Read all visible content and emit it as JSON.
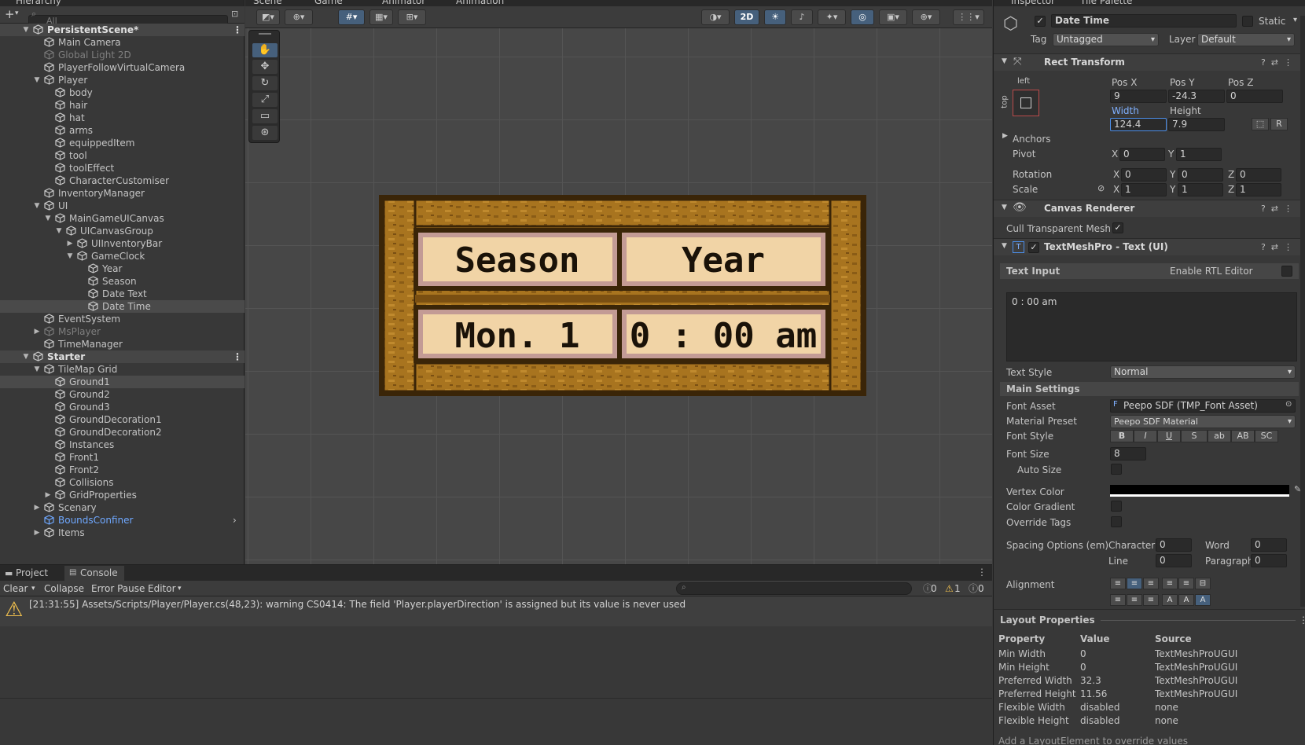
{
  "hierarchy": {
    "tab": "Hierarchy",
    "search_placeholder": "All",
    "rows": [
      {
        "label": "PersistentScene*",
        "depth": 0,
        "type": "scene",
        "arrow": "▼"
      },
      {
        "label": "Main Camera",
        "depth": 1,
        "arrow": ""
      },
      {
        "label": "Global Light 2D",
        "depth": 1,
        "arrow": "",
        "dim": true
      },
      {
        "label": "PlayerFollowVirtualCamera",
        "depth": 1,
        "arrow": ""
      },
      {
        "label": "Player",
        "depth": 1,
        "arrow": "▼"
      },
      {
        "label": "body",
        "depth": 2,
        "arrow": ""
      },
      {
        "label": "hair",
        "depth": 2,
        "arrow": ""
      },
      {
        "label": "hat",
        "depth": 2,
        "arrow": ""
      },
      {
        "label": "arms",
        "depth": 2,
        "arrow": ""
      },
      {
        "label": "equippedItem",
        "depth": 2,
        "arrow": ""
      },
      {
        "label": "tool",
        "depth": 2,
        "arrow": ""
      },
      {
        "label": "toolEffect",
        "depth": 2,
        "arrow": ""
      },
      {
        "label": "CharacterCustomiser",
        "depth": 2,
        "arrow": ""
      },
      {
        "label": "InventoryManager",
        "depth": 1,
        "arrow": ""
      },
      {
        "label": "UI",
        "depth": 1,
        "arrow": "▼"
      },
      {
        "label": "MainGameUICanvas",
        "depth": 2,
        "arrow": "▼"
      },
      {
        "label": "UICanvasGroup",
        "depth": 3,
        "arrow": "▼"
      },
      {
        "label": "UIInventoryBar",
        "depth": 4,
        "arrow": "▶"
      },
      {
        "label": "GameClock",
        "depth": 4,
        "arrow": "▼"
      },
      {
        "label": "Year",
        "depth": 5,
        "arrow": ""
      },
      {
        "label": "Season",
        "depth": 5,
        "arrow": ""
      },
      {
        "label": "Date Text",
        "depth": 5,
        "arrow": ""
      },
      {
        "label": "Date Time",
        "depth": 5,
        "arrow": "",
        "selected": true
      },
      {
        "label": "EventSystem",
        "depth": 1,
        "arrow": ""
      },
      {
        "label": "MsPlayer",
        "depth": 1,
        "arrow": "▶",
        "dim": true
      },
      {
        "label": "TimeManager",
        "depth": 1,
        "arrow": ""
      },
      {
        "label": "Starter",
        "depth": 0,
        "type": "scene",
        "arrow": "▼"
      },
      {
        "label": "TileMap Grid",
        "depth": 1,
        "arrow": "▼"
      },
      {
        "label": "Ground1",
        "depth": 2,
        "arrow": "",
        "hover": true
      },
      {
        "label": "Ground2",
        "depth": 2,
        "arrow": ""
      },
      {
        "label": "Ground3",
        "depth": 2,
        "arrow": ""
      },
      {
        "label": "GroundDecoration1",
        "depth": 2,
        "arrow": ""
      },
      {
        "label": "GroundDecoration2",
        "depth": 2,
        "arrow": ""
      },
      {
        "label": "Instances",
        "depth": 2,
        "arrow": ""
      },
      {
        "label": "Front1",
        "depth": 2,
        "arrow": ""
      },
      {
        "label": "Front2",
        "depth": 2,
        "arrow": ""
      },
      {
        "label": "Collisions",
        "depth": 2,
        "arrow": ""
      },
      {
        "label": "GridProperties",
        "depth": 2,
        "arrow": "▶"
      },
      {
        "label": "Scenary",
        "depth": 1,
        "arrow": "▶"
      },
      {
        "label": "BoundsConfiner",
        "depth": 1,
        "arrow": "",
        "blue": true
      },
      {
        "label": "Items",
        "depth": 1,
        "arrow": "▶"
      }
    ]
  },
  "scene": {
    "tabs": [
      "Scene",
      "Game",
      "Animator",
      "Animation"
    ],
    "toggle_2d": "2D",
    "clock": {
      "season": "Season",
      "year": "Year",
      "date": "Mon. 1",
      "time": "0 : 00 am"
    }
  },
  "inspector": {
    "tabs": [
      "Inspector",
      "Tile Palette"
    ],
    "object_name": "Date Time",
    "static_label": "Static",
    "tag_label": "Tag",
    "tag_value": "Untagged",
    "layer_label": "Layer",
    "layer_value": "Default",
    "rect_transform": {
      "title": "Rect Transform",
      "anchor_h": "left",
      "anchor_v": "top",
      "pos_x_label": "Pos X",
      "pos_x": "9",
      "pos_y_label": "Pos Y",
      "pos_y": "-24.3",
      "pos_z_label": "Pos Z",
      "pos_z": "0",
      "width_label": "Width",
      "width": "124.4",
      "height_label": "Height",
      "height": "7.9",
      "r_button": "R",
      "anchors_label": "Anchors",
      "pivot_label": "Pivot",
      "pivot_x": "0",
      "pivot_y": "1",
      "rotation_label": "Rotation",
      "rot_x": "0",
      "rot_y": "0",
      "rot_z": "0",
      "scale_label": "Scale",
      "scale_x": "1",
      "scale_y": "1",
      "scale_z": "1",
      "axis_x": "X",
      "axis_y": "Y",
      "axis_z": "Z"
    },
    "canvas_renderer": {
      "title": "Canvas Renderer",
      "cull_label": "Cull Transparent Mesh"
    },
    "tmp": {
      "title": "TextMeshPro - Text (UI)",
      "text_input_label": "Text Input",
      "rtl_label": "Enable RTL Editor",
      "text_value": "0 : 00 am",
      "text_style_label": "Text Style",
      "text_style_value": "Normal",
      "main_settings_label": "Main Settings",
      "font_asset_label": "Font Asset",
      "font_asset_value": "Peepo SDF (TMP_Font Asset)",
      "material_label": "Material Preset",
      "material_value": "Peepo SDF Material",
      "font_style_label": "Font Style",
      "font_style_buttons": [
        "B",
        "I",
        "U",
        "S",
        "ab",
        "AB",
        "SC"
      ],
      "font_size_label": "Font Size",
      "font_size_value": "8",
      "auto_size_label": "Auto Size",
      "vertex_color_label": "Vertex Color",
      "vertex_color": "#000000",
      "color_gradient_label": "Color Gradient",
      "override_tags_label": "Override Tags",
      "spacing_label": "Spacing Options (em)",
      "character_label": "Character",
      "character_value": "0",
      "word_label": "Word",
      "word_value": "0",
      "line_label": "Line",
      "line_value": "0",
      "paragraph_label": "Paragraph",
      "paragraph_value": "0",
      "alignment_label": "Alignment"
    }
  },
  "layout_properties": {
    "title": "Layout Properties",
    "headers": [
      "Property",
      "Value",
      "Source"
    ],
    "rows": [
      [
        "Min Width",
        "0",
        "TextMeshProUGUI"
      ],
      [
        "Min Height",
        "0",
        "TextMeshProUGUI"
      ],
      [
        "Preferred Width",
        "32.3",
        "TextMeshProUGUI"
      ],
      [
        "Preferred Height",
        "11.56",
        "TextMeshProUGUI"
      ],
      [
        "Flexible Width",
        "disabled",
        "none"
      ],
      [
        "Flexible Height",
        "disabled",
        "none"
      ]
    ],
    "footer": "Add a LayoutElement to override values"
  },
  "console": {
    "tabs": [
      "Project",
      "Console"
    ],
    "clear": "Clear",
    "collapse": "Collapse",
    "error_pause": "Error Pause",
    "editor": "Editor",
    "count_info": "0",
    "count_warn": "1",
    "count_error": "0",
    "log_message": "[21:31:55] Assets/Scripts/Player/Player.cs(48,23): warning CS0414: The field 'Player.playerDirection' is assigned but its value is never used"
  },
  "colors": {
    "accent": "#46607c",
    "wood": "#a8741f",
    "wood_dark": "#5a3a10",
    "plank_face": "#f1d4a6",
    "warning": "#f2c14e"
  }
}
